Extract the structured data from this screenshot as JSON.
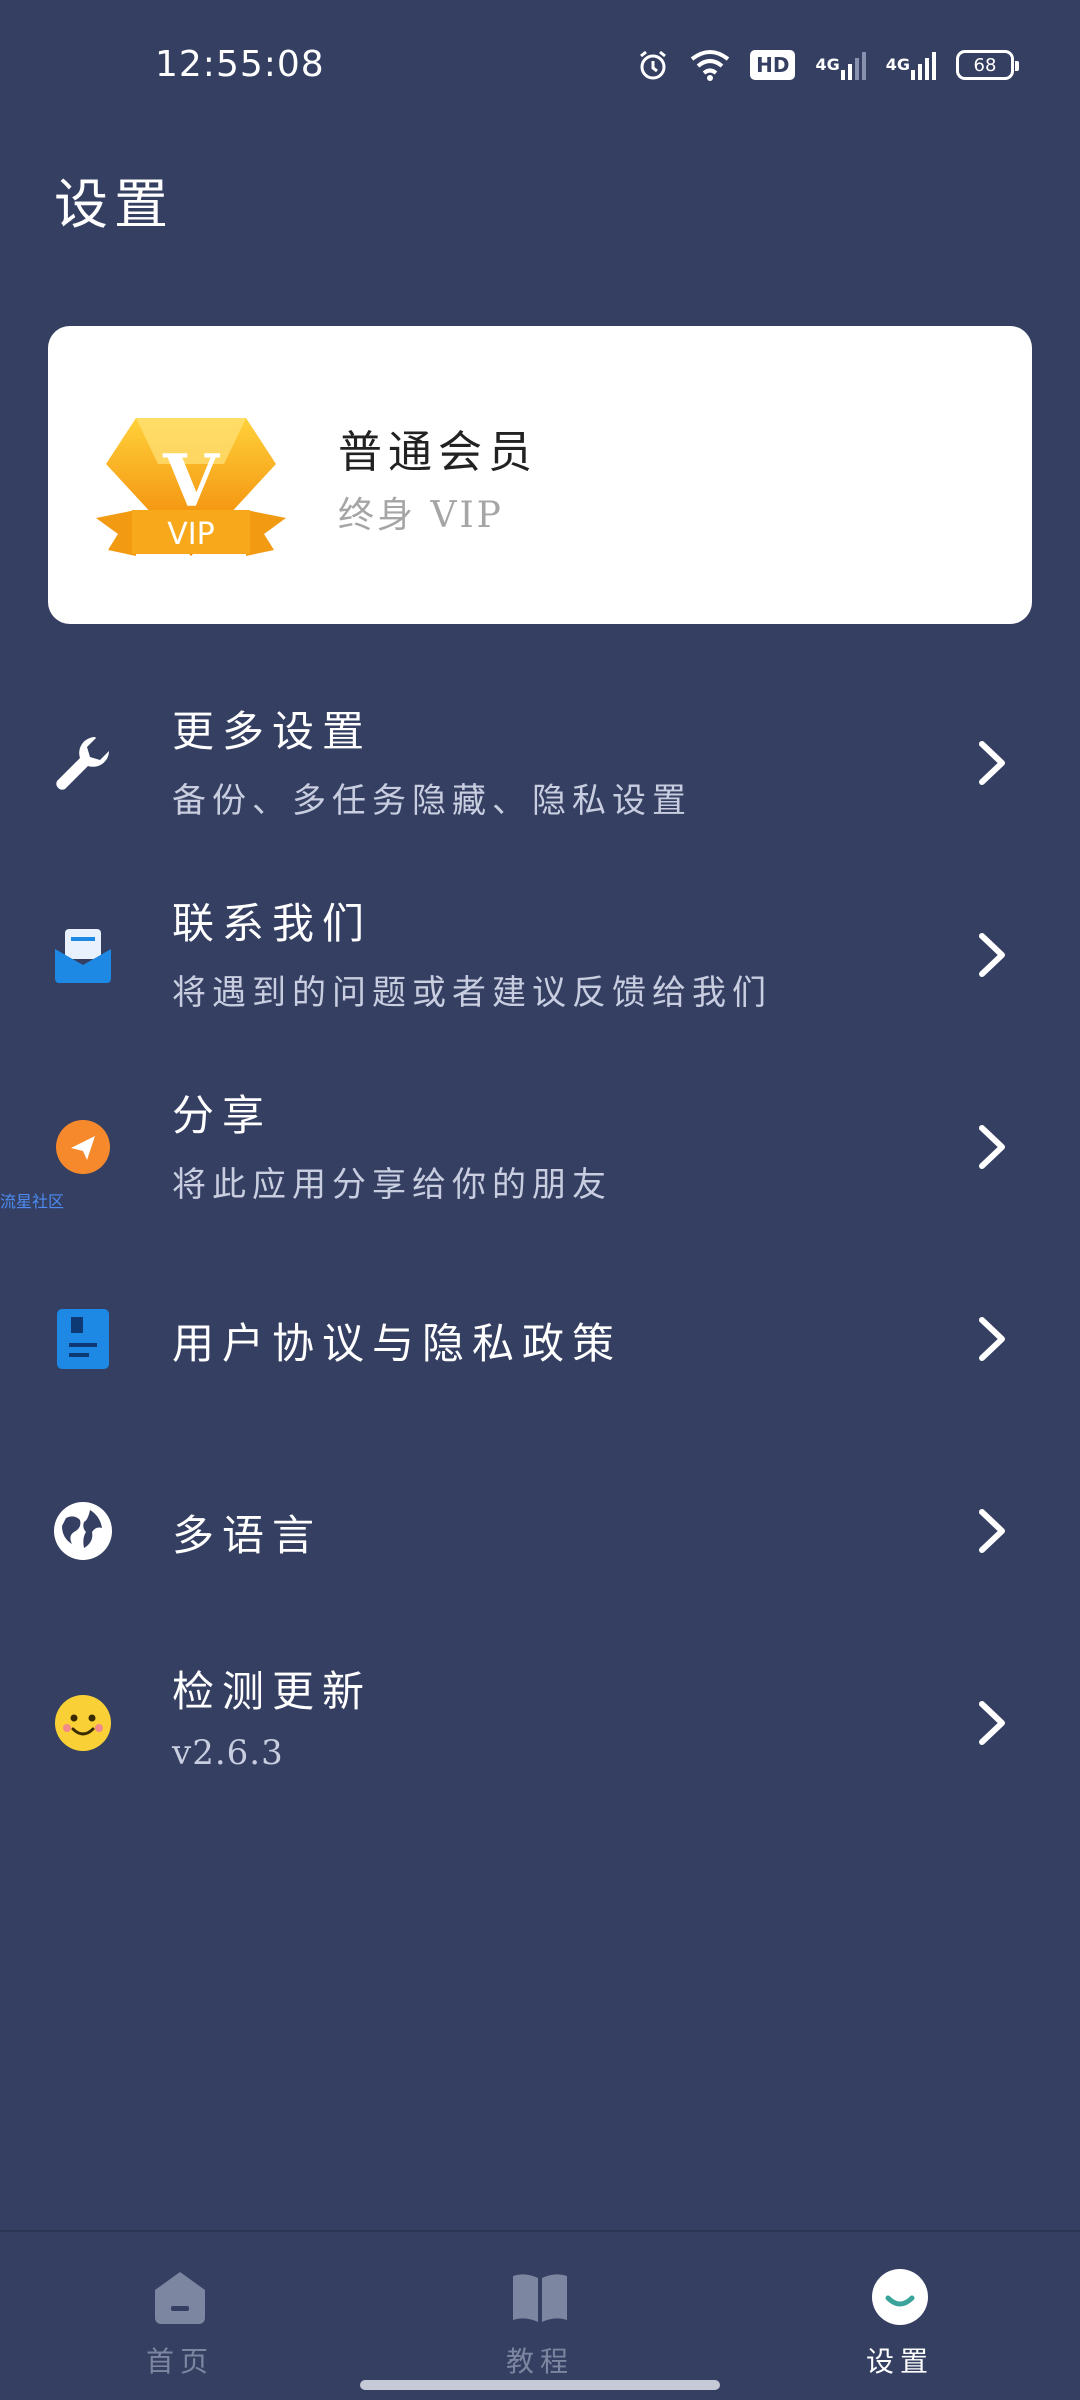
{
  "status_bar": {
    "time": "12:55:08",
    "hd_label": "HD",
    "net1": "4G",
    "net2": "4G",
    "battery": "68"
  },
  "page": {
    "title": "设置"
  },
  "vip": {
    "badge_text": "VIP",
    "badge_letter": "V",
    "title": "普通会员",
    "subtitle": "终身 VIP"
  },
  "menu": {
    "items": [
      {
        "title": "更多设置",
        "desc": "备份、多任务隐藏、隐私设置",
        "icon": "wrench-icon"
      },
      {
        "title": "联系我们",
        "desc": "将遇到的问题或者建议反馈给我们",
        "icon": "mail-icon"
      },
      {
        "title": "分享",
        "desc": "将此应用分享给你的朋友",
        "icon": "share-plane-icon"
      },
      {
        "title": "用户协议与隐私政策",
        "desc": "",
        "icon": "document-icon"
      },
      {
        "title": "多语言",
        "desc": "",
        "icon": "globe-icon"
      },
      {
        "title": "检测更新",
        "desc": "v2.6.3",
        "icon": "smiley-icon"
      }
    ]
  },
  "watermark": "流星社区",
  "bottom_nav": {
    "items": [
      {
        "label": "首页",
        "icon": "home-icon",
        "active": false
      },
      {
        "label": "教程",
        "icon": "book-icon",
        "active": false
      },
      {
        "label": "设置",
        "icon": "settings-smile-icon",
        "active": true
      }
    ]
  },
  "colors": {
    "background": "#353f62",
    "card": "#ffffff",
    "accent_orange": "#f5a623",
    "accent_blue": "#1e88e5",
    "active_nav": "#ffffff",
    "inactive_nav": "#7d86a0"
  }
}
